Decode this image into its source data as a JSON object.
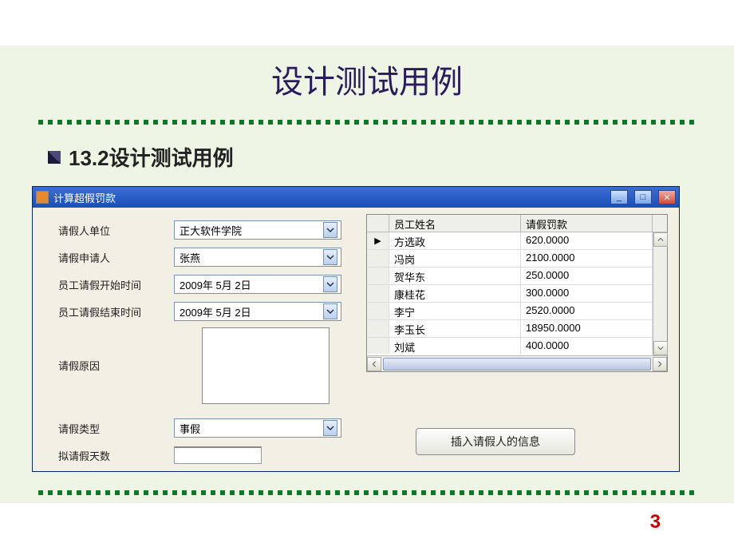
{
  "slide": {
    "title": "设计测试用例",
    "subtitle": "13.2设计测试用例",
    "page_number": "3"
  },
  "window": {
    "title": "计算超假罚款",
    "labels": {
      "unit": "请假人单位",
      "applicant": "请假申请人",
      "start": "员工请假开始时间",
      "end": "员工请假结束时间",
      "reason": "请假原因",
      "type": "请假类型",
      "days": "拟请假天数"
    },
    "values": {
      "unit": "正大软件学院",
      "applicant": "张燕",
      "start": "2009年 5月 2日",
      "end": "2009年 5月 2日",
      "type": "事假",
      "days": ""
    },
    "button": "插入请假人的信息"
  },
  "grid": {
    "headers": {
      "name": "员工姓名",
      "fine": "请假罚款"
    },
    "rows": [
      {
        "name": "方选政",
        "fine": "620.0000"
      },
      {
        "name": "冯岗",
        "fine": "2100.0000"
      },
      {
        "name": "贺华东",
        "fine": "250.0000"
      },
      {
        "name": "康桂花",
        "fine": "300.0000"
      },
      {
        "name": "李宁",
        "fine": "2520.0000"
      },
      {
        "name": "李玉长",
        "fine": "18950.0000"
      },
      {
        "name": "刘斌",
        "fine": "400.0000"
      }
    ]
  }
}
